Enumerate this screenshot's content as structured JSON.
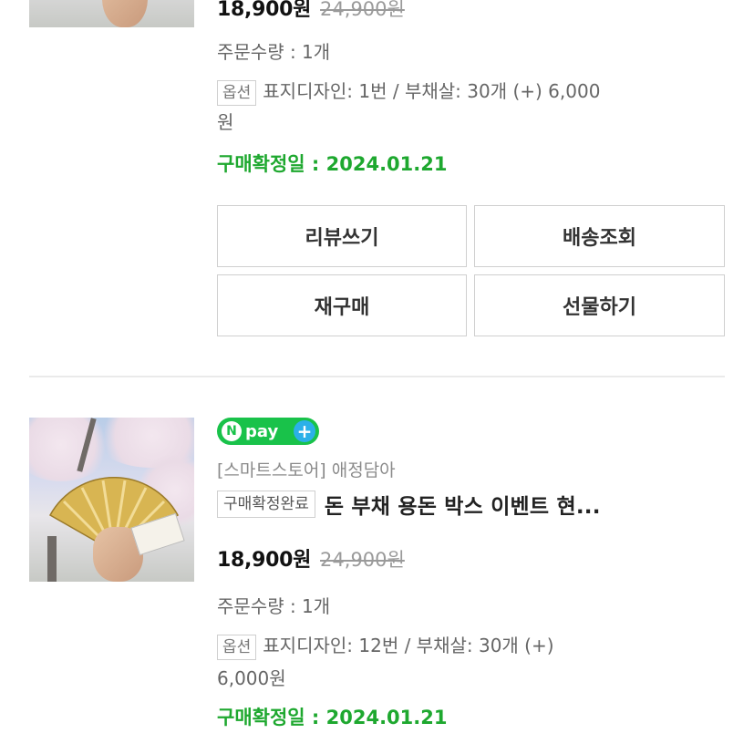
{
  "order1": {
    "price": "18,900원",
    "original_price": "24,900원",
    "quantity": "주문수량 : 1개",
    "option_tag": "옵션",
    "option_line1": "표지디자인: 1번 / 부채살: 30개 (+) 6,000",
    "option_line2": "원",
    "confirm_date": "구매확정일 : 2024.01.21",
    "buttons": {
      "review": "리뷰쓰기",
      "tracking": "배송조회",
      "reorder": "재구매",
      "gift": "선물하기"
    }
  },
  "order2": {
    "payment_badge": "pay",
    "payment_badge_n": "N",
    "payment_badge_plus": "+",
    "store": "[스마트스토어] 애정담아",
    "status": "구매확정완료",
    "title": "돈 부채 용돈 박스 이벤트 현...",
    "price": "18,900원",
    "original_price": "24,900원",
    "quantity": "주문수량 : 1개",
    "option_tag": "옵션",
    "option_line1": "표지디자인: 12번 / 부채살: 30개 (+)",
    "option_line2": "6,000원",
    "confirm_date": "구매확정일 : 2024.01.21"
  },
  "colors": {
    "confirm_green": "#1ea82f",
    "npay_green": "#19c24a",
    "npay_plus_blue": "#2bb0e8"
  }
}
